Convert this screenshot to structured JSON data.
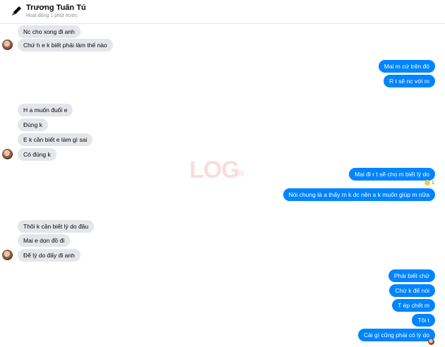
{
  "header": {
    "name": "Trương Tuấn Tú",
    "status": "Hoạt động 1 phút trước"
  },
  "watermark": {
    "main": "LOG",
    "sub": ".vn"
  },
  "reaction": {
    "icon": "laugh-emoji-icon",
    "count": "1"
  },
  "messages": [
    {
      "side": "in",
      "text": "Nc cho xong đi anh"
    },
    {
      "side": "in",
      "text": "Chứ h e k biết phải làm thế nào"
    },
    {
      "side": "out",
      "text": "Mai m cứ trên đó"
    },
    {
      "side": "out",
      "text": "R t sẽ nc với m"
    },
    {
      "side": "in",
      "text": "H a muốn đuổi e"
    },
    {
      "side": "in",
      "text": "Đúng k"
    },
    {
      "side": "in",
      "text": "E k cần biết e làm gì sai"
    },
    {
      "side": "in",
      "text": "Có đúng k"
    },
    {
      "side": "out",
      "text": "Mai đi r t sẽ cho m biết lý do"
    },
    {
      "side": "out",
      "text": "Nói chung là a thấy m k dc nên a k muốn giúp m nữa"
    },
    {
      "side": "in",
      "text": "Thôi k cần biết lý do đâu"
    },
    {
      "side": "in",
      "text": "Mai e dọn đồ đi"
    },
    {
      "side": "in",
      "text": "Để lý do đấy đi anh"
    },
    {
      "side": "out",
      "text": "Phải biết chứ"
    },
    {
      "side": "out",
      "text": "Chứ k để nói"
    },
    {
      "side": "out",
      "text": "T ép chết m"
    },
    {
      "side": "out",
      "text": "Tôi t"
    },
    {
      "side": "out",
      "text": "Cái gì cũng phải có lý do"
    }
  ],
  "colors": {
    "outgoing": "#0084ff",
    "incoming": "#e4e6eb"
  }
}
